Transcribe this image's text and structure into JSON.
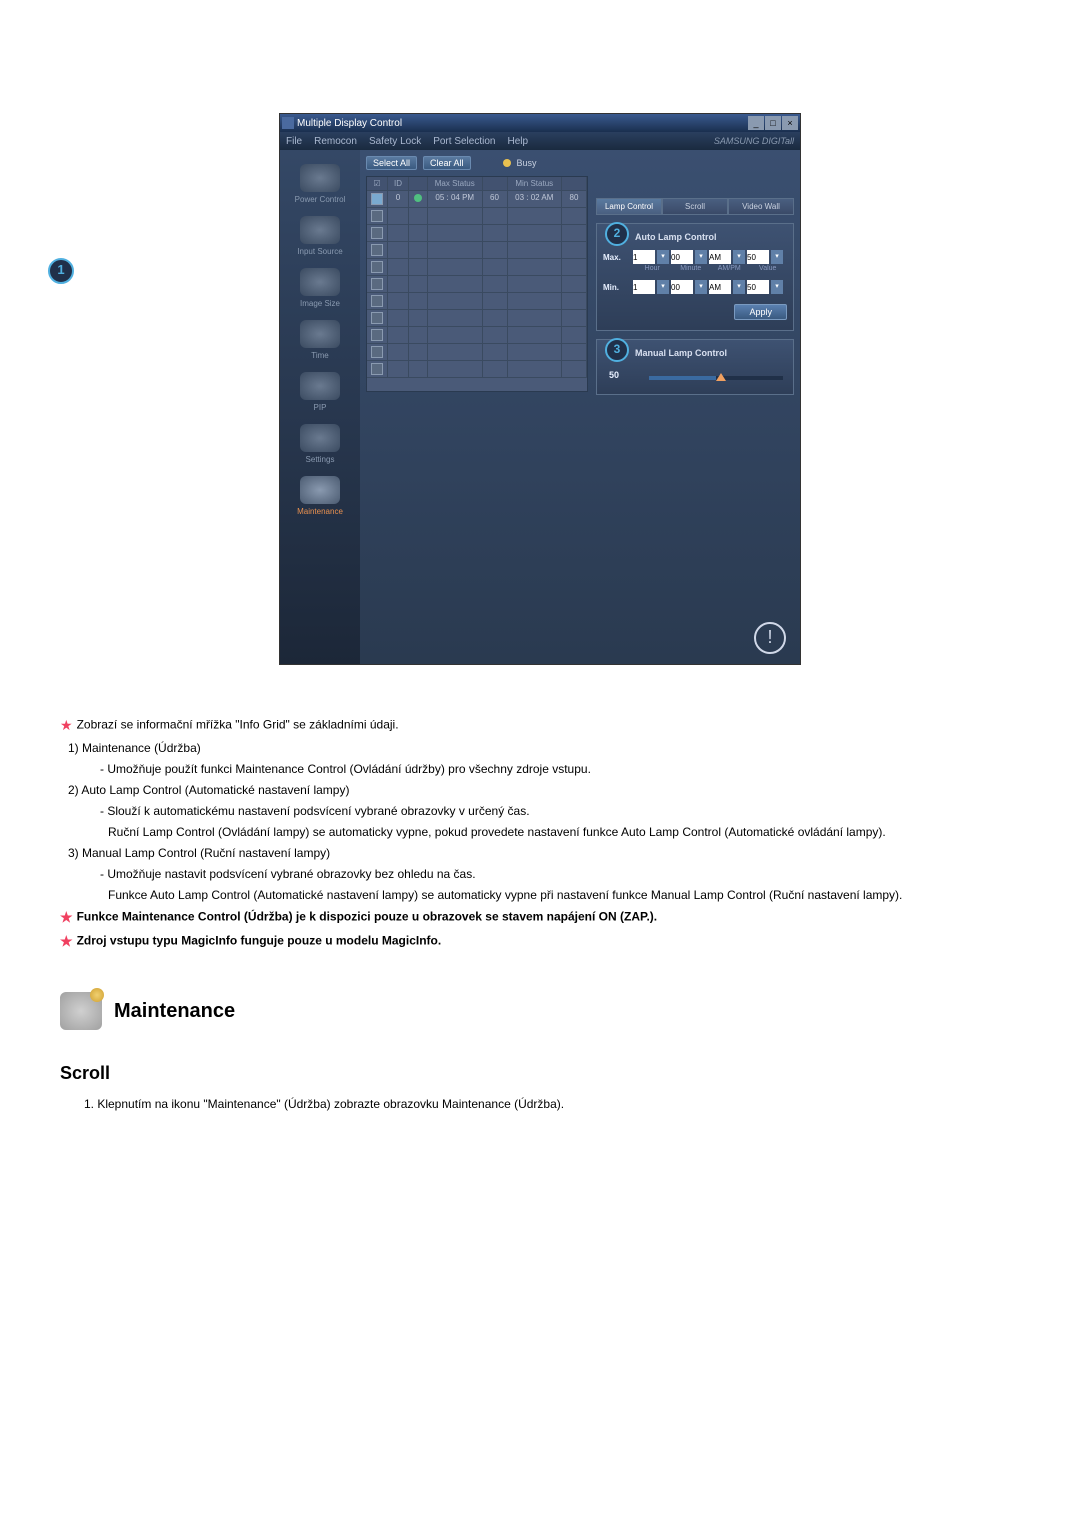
{
  "window": {
    "title": "Multiple Display Control"
  },
  "window_buttons": {
    "min": "_",
    "max": "□",
    "close": "×"
  },
  "menubar": {
    "file": "File",
    "remocon": "Remocon",
    "safety": "Safety Lock",
    "port": "Port Selection",
    "help": "Help",
    "brand": "SAMSUNG DIGITall"
  },
  "sidebar": [
    {
      "label": "Power Control"
    },
    {
      "label": "Input Source"
    },
    {
      "label": "Image Size"
    },
    {
      "label": "Time"
    },
    {
      "label": "PIP"
    },
    {
      "label": "Settings"
    },
    {
      "label": "Maintenance"
    }
  ],
  "toolbar": {
    "select_all": "Select All",
    "clear_all": "Clear All",
    "busy": "Busy"
  },
  "grid": {
    "head": {
      "chk": "☑",
      "id": "ID",
      "stat": "",
      "max_status": "Max Status",
      "maxv": "",
      "min_status": "Min Status",
      "minv": ""
    },
    "rows": [
      {
        "chk": "on",
        "id": "0",
        "stat": "on",
        "max_status": "05 : 04 PM",
        "maxv": "60",
        "min_status": "03 : 02 AM",
        "minv": "80"
      }
    ],
    "empty_rows": 10
  },
  "tabs": {
    "lamp": "Lamp Control",
    "scroll": "Scroll",
    "video": "Video Wall"
  },
  "auto_box": {
    "title": "Auto Lamp Control",
    "callout": "2",
    "rows": [
      {
        "lbl": "Max.",
        "hour": "1",
        "minute": "00",
        "ampm": "AM",
        "value": "50"
      },
      {
        "lbl": "Min.",
        "hour": "1",
        "minute": "00",
        "ampm": "AM",
        "value": "50"
      }
    ],
    "sublabels": {
      "hour": "Hour",
      "minute": "Minute",
      "ampm": "AM/PM",
      "value": "Value"
    },
    "apply": "Apply"
  },
  "manual_box": {
    "title": "Manual Lamp Control",
    "callout": "3",
    "value": "50"
  },
  "callout1": "1",
  "doc": {
    "p1": "Zobrazí se informační mřížka \"Info Grid\" se základními údaji.",
    "i1_t": "Maintenance (Údržba)",
    "i1_1": "- Umožňuje použít funkci Maintenance Control (Ovládání údržby) pro všechny zdroje vstupu.",
    "i2_t": "Auto Lamp Control (Automatické nastavení lampy)",
    "i2_1": "- Slouží k automatickému nastavení podsvícení vybrané obrazovky v určený čas.",
    "i2_2": "Ruční Lamp Control (Ovládání lampy) se automaticky vypne, pokud provedete nastavení funkce Auto Lamp Control (Automatické ovládání lampy).",
    "i3_t": "Manual Lamp Control (Ruční nastavení lampy)",
    "i3_1": "- Umožňuje nastavit podsvícení vybrané obrazovky bez ohledu na čas.",
    "i3_2": "Funkce Auto Lamp Control (Automatické nastavení lampy) se automaticky vypne při nastavení funkce Manual Lamp Control (Ruční nastavení lampy).",
    "p_bold1": "Funkce Maintenance Control (Údržba) je k dispozici pouze u obrazovek se stavem napájení ON (ZAP.).",
    "p_bold2": "Zdroj vstupu typu MagicInfo funguje pouze u modelu MagicInfo.",
    "section": "Maintenance",
    "sub": "Scroll",
    "step1": "1.  Klepnutím na ikonu \"Maintenance\" (Údržba) zobrazte obrazovku Maintenance (Údržba)."
  }
}
